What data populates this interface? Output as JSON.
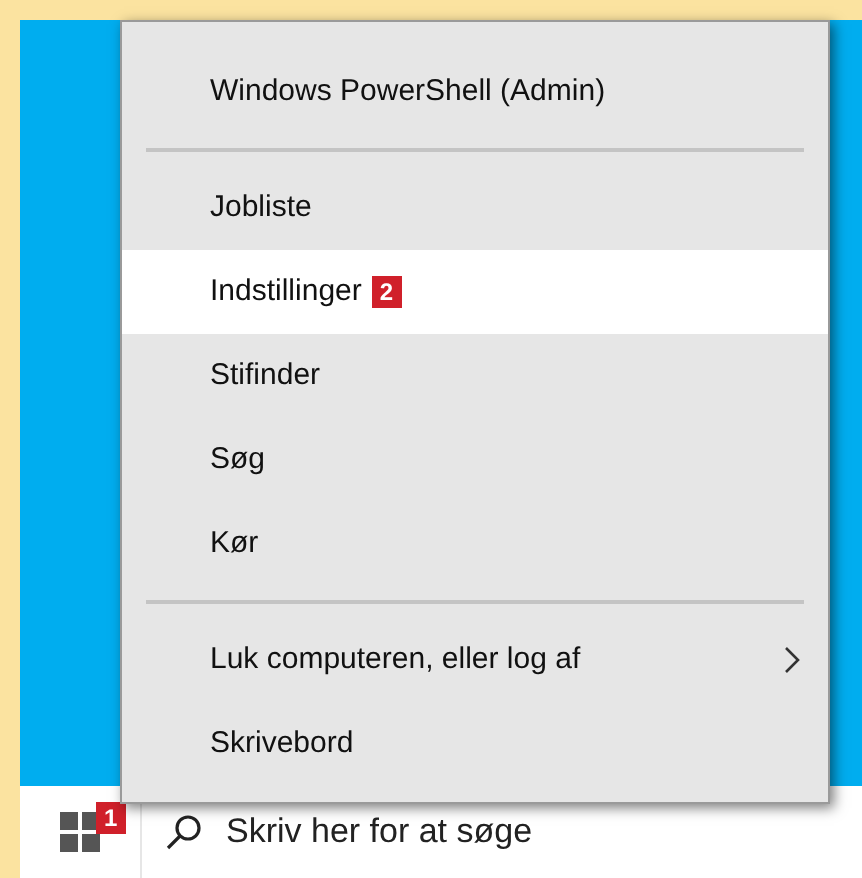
{
  "menu": {
    "groups": [
      [
        {
          "label": "Windows PowerShell (Admin)",
          "selected": false
        }
      ],
      [
        {
          "label": "Jobliste",
          "selected": false
        },
        {
          "label": "Indstillinger",
          "selected": true,
          "badge": "2"
        },
        {
          "label": "Stifinder",
          "selected": false
        },
        {
          "label": "Søg",
          "selected": false
        },
        {
          "label": "Kør",
          "selected": false
        }
      ],
      [
        {
          "label": "Luk computeren, eller log af",
          "selected": false,
          "submenu": true
        },
        {
          "label": "Skrivebord",
          "selected": false
        }
      ]
    ]
  },
  "taskbar": {
    "start_badge": "1",
    "search": {
      "placeholder": "Skriv her for at søge"
    }
  }
}
